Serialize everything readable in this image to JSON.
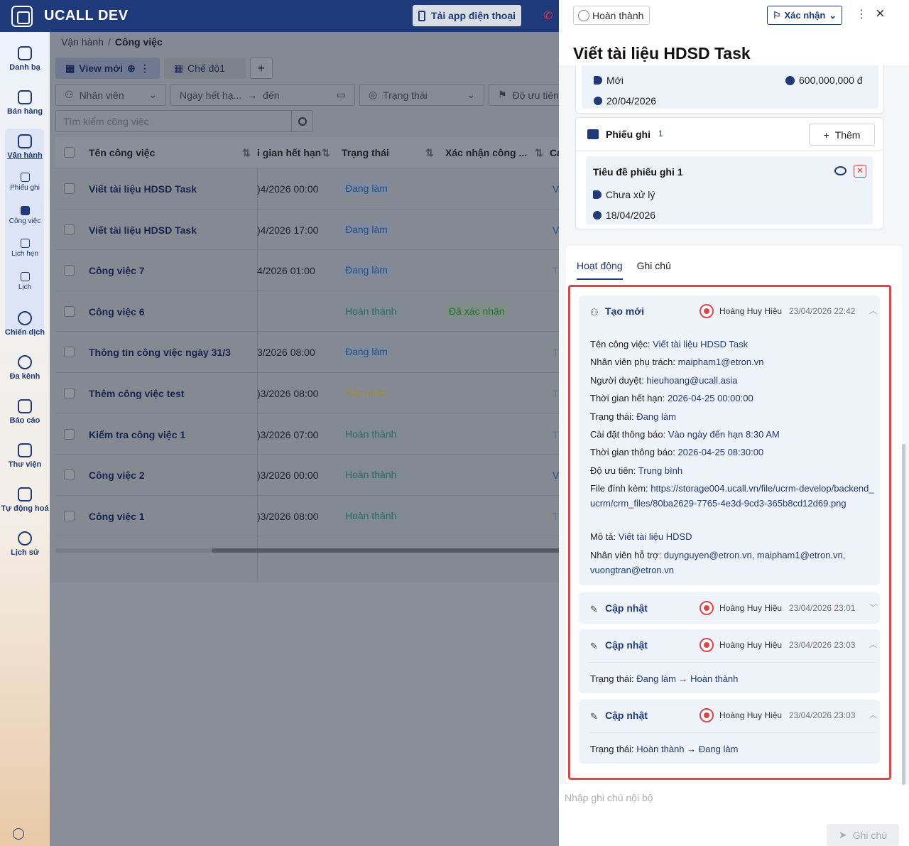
{
  "app": {
    "name": "UCALL DEV",
    "download_label": "Tải app điện thoại"
  },
  "sidebar": {
    "items": [
      {
        "label": "Danh bạ"
      },
      {
        "label": "Bán hàng"
      },
      {
        "label": "Vận hành"
      },
      {
        "label": "Chiến dịch"
      },
      {
        "label": "Đa kênh"
      },
      {
        "label": "Báo cáo"
      },
      {
        "label": "Thư viện"
      },
      {
        "label": "Tự động hoá"
      },
      {
        "label": "Lịch sử"
      }
    ],
    "subitems": [
      {
        "label": "Phiếu ghi"
      },
      {
        "label": "Công việc"
      },
      {
        "label": "Lịch hẹn"
      },
      {
        "label": "Lịch"
      }
    ]
  },
  "breadcrumb": {
    "parent": "Vận hành",
    "current": "Công việc"
  },
  "views": {
    "active": "View mới",
    "other": "Chế độ1"
  },
  "filters": {
    "employee": "Nhân viên",
    "due_from": "Ngày hết hạ...",
    "due_arrow": "→",
    "due_to": "đến",
    "status": "Trạng thái",
    "priority": "Độ ưu tiên"
  },
  "search": {
    "placeholder": "Tìm kiếm công việc"
  },
  "table": {
    "headers": {
      "name": "Tên công việc",
      "due": "i gian hết hạn",
      "status": "Trạng thái",
      "confirm": "Xác nhận công ...",
      "extra": "Cá"
    },
    "rows": [
      {
        "name": "Viết tài liệu HDSD Task",
        "due": ")4/2026 00:00",
        "status": "Đang làm",
        "confirm": "",
        "extra": "V"
      },
      {
        "name": "Viết tài liệu HDSD Task",
        "due": ")4/2026 17:00",
        "status": "Đang làm",
        "confirm": "",
        "extra": "V"
      },
      {
        "name": "Công việc 7",
        "due": "4/2026 01:00",
        "status": "Đang làm",
        "confirm": "",
        "extra": "T"
      },
      {
        "name": "Công việc 6",
        "due": "",
        "status": "Hoàn thành",
        "confirm": "Đã xác nhận",
        "extra": ""
      },
      {
        "name": "Thông tin công việc ngày 31/3",
        "due": "3/2026 08:00",
        "status": "Đang làm",
        "confirm": "",
        "extra": "T"
      },
      {
        "name": "Thêm công việc test",
        "due": ")3/2026 08:00",
        "status": "Xác nhận",
        "confirm": "",
        "extra": "T"
      },
      {
        "name": "Kiểm tra công việc 1",
        "due": ")3/2026 07:00",
        "status": "Hoàn thành",
        "confirm": "",
        "extra": "T"
      },
      {
        "name": "Công việc 2",
        "due": ")3/2026 00:00",
        "status": "Hoàn thành",
        "confirm": "",
        "extra": "V"
      },
      {
        "name": "Công việc 1",
        "due": ")3/2026 08:00",
        "status": "Hoàn thành",
        "confirm": "",
        "extra": "T"
      }
    ]
  },
  "drawer": {
    "complete_label": "Hoàn thành",
    "confirm_label": "Xác nhận",
    "title": "Viết tài liệu HDSD Task",
    "info": {
      "status": "Mới",
      "amount": "600,000,000 đ",
      "date": "20/04/2026"
    },
    "notes_section": {
      "title": "Phiếu ghi",
      "count": "1",
      "add_label": "Thêm",
      "item": {
        "title": "Tiêu đề phiếu ghi 1",
        "status": "Chưa xử lý",
        "date": "18/04/2026"
      }
    },
    "tabs": {
      "activity": "Hoạt động",
      "notes": "Ghi chú"
    },
    "activities": [
      {
        "type": "Tạo mới",
        "user": "Hoàng Huy Hiệu",
        "time": "23/04/2026 22:42",
        "fields": [
          {
            "label": "Tên công việc: ",
            "value": "Viết tài liệu HDSD Task"
          },
          {
            "label": "Nhân viên phụ trách: ",
            "value": "maipham1@etron.vn"
          },
          {
            "label": "Người duyệt: ",
            "value": "hieuhoang@ucall.asia"
          },
          {
            "label": "Thời gian hết hạn: ",
            "value": "2026-04-25 00:00:00"
          },
          {
            "label": "Trạng thái: ",
            "value": "Đang làm"
          },
          {
            "label": "Cài đặt thông báo: ",
            "value": "Vào ngày đến hạn 8:30 AM"
          },
          {
            "label": "Thời gian thông báo: ",
            "value": "2026-04-25 08:30:00"
          },
          {
            "label": "Độ ưu tiên: ",
            "value": "Trung bình"
          },
          {
            "label": "File đính kèm: ",
            "value": "https://storage004.ucall.vn/file/ucrm-develop/backend_ucrm/crm_files/80ba2629-7765-4e3d-9cd3-365b8cd12d69.png"
          },
          {
            "label": "Mô tả: ",
            "value": "Viết tài liệu HDSD"
          },
          {
            "label": "Nhân viên hỗ trợ: ",
            "value": "duynguyen@etron.vn, maipham1@etron.vn, vuongtran@etron.vn"
          }
        ]
      },
      {
        "type": "Cập nhật",
        "user": "Hoàng Huy Hiệu",
        "time": "23/04/2026 23:01"
      },
      {
        "type": "Cập nhật",
        "user": "Hoàng Huy Hiệu",
        "time": "23/04/2026 23:03",
        "change": {
          "label": "Trạng thái: ",
          "from": "Đang làm",
          "arrow": "→",
          "to": "Hoàn thành"
        }
      },
      {
        "type": "Cập nhật",
        "user": "Hoàng Huy Hiệu",
        "time": "23/04/2026 23:03",
        "change": {
          "label": "Trạng thái: ",
          "from": "Hoàn thành",
          "arrow": "→",
          "to": "Đang làm"
        }
      }
    ],
    "note_input": {
      "placeholder": "Nhập ghi chú nội bộ"
    },
    "send_label": "Ghi chú"
  },
  "colors": {
    "brand": "#1f3a7a",
    "danger": "#e04545",
    "overlay": "#858992"
  },
  "icons": [
    "logo-icon",
    "phone-icon",
    "call-icon",
    "contacts-icon",
    "sales-icon",
    "operations-icon",
    "campaign-icon",
    "omnichannel-icon",
    "report-icon",
    "library-icon",
    "automation-icon",
    "history-icon",
    "globe-icon",
    "search-icon",
    "user-icon",
    "calendar-icon",
    "flag-icon",
    "tag-icon",
    "money-icon",
    "clock-icon",
    "grid-icon",
    "eye-icon",
    "delete-icon",
    "edit-icon",
    "chevron-up-icon",
    "chevron-down-icon",
    "send-icon",
    "close-icon"
  ]
}
